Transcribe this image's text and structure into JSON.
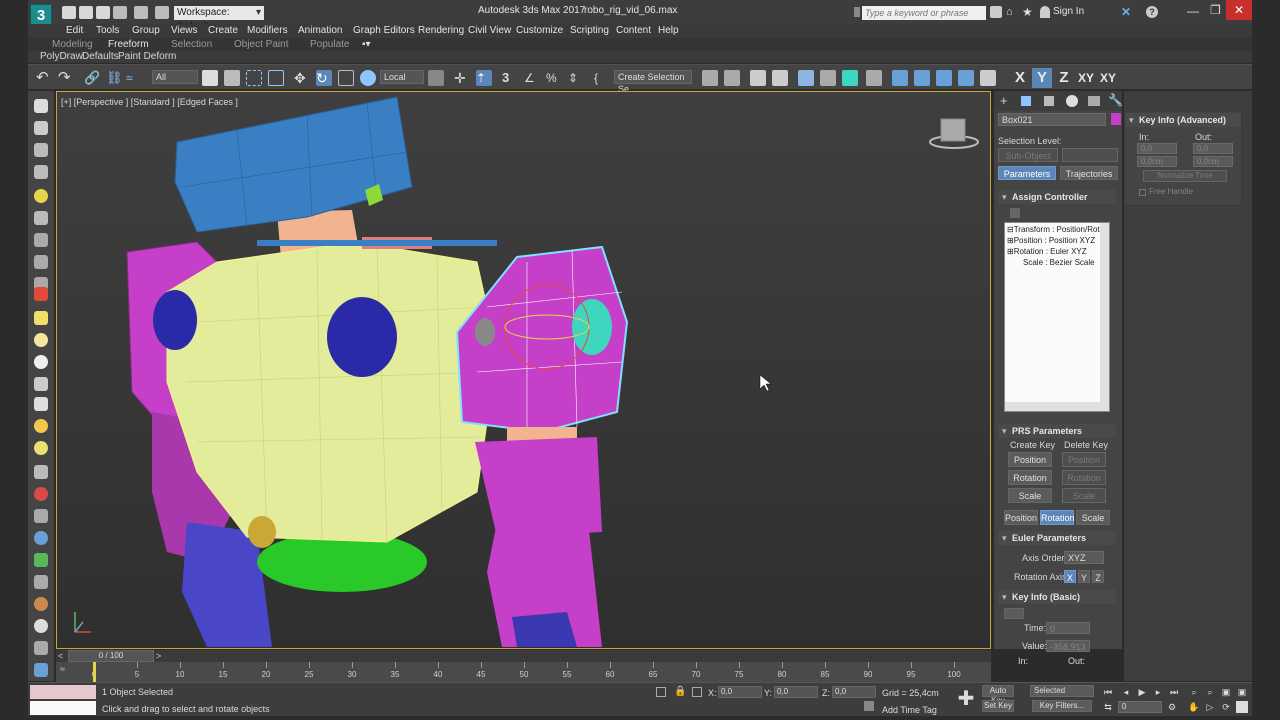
{
  "app": {
    "logo_label": "3",
    "logo_sub": "MAX",
    "title": "Autodesk 3ds Max 2017",
    "filename": "robo_rig_vid_06.max",
    "workspace_label": "Workspace: Default",
    "search_placeholder": "Type a keyword or phrase",
    "sign_in": "Sign In",
    "help": "?"
  },
  "menu": [
    "Edit",
    "Tools",
    "Group",
    "Views",
    "Create",
    "Modifiers",
    "Animation",
    "Graph Editors",
    "Rendering",
    "Civil View",
    "Customize",
    "Scripting",
    "Content",
    "Help"
  ],
  "ribbon": {
    "tabs": [
      "Modeling",
      "Freeform",
      "Selection",
      "Object Paint",
      "Populate"
    ],
    "active_tab": "Freeform",
    "subtabs": [
      "PolyDraw",
      "Defaults",
      "Paint Deform"
    ]
  },
  "toolbar": {
    "filter": "All",
    "ref_coord": "Local",
    "selection_set": "Create Selection Se",
    "axes": [
      "X",
      "Y",
      "Z",
      "XY",
      "XY"
    ],
    "active_axis": "Y"
  },
  "viewport": {
    "label": "[+] [Perspective ] [Standard ] [Edged Faces ]",
    "colors": {
      "border": "#c7a53a",
      "head": "#3a7fc4",
      "body": "#e3ec9a",
      "limb": "#c63fc8",
      "joint": "#2a2aa8",
      "hip": "#28c928",
      "neck": "#f2b391",
      "accent": "#3fd6c0"
    }
  },
  "command_panel": {
    "object_name": "Box021",
    "object_color": "#c63fc8",
    "selection_level_label": "Selection Level:",
    "sub_object": "Sub-Object",
    "tabs": [
      "Parameters",
      "Trajectories"
    ],
    "active_tab": "Parameters",
    "assign_controller": "Assign Controller",
    "tree": [
      "⊟Transform : Position/Rotat",
      "  ⊞Position : Position XYZ",
      "  ⊞Rotation : Euler XYZ",
      "  Scale : Bezier Scale"
    ],
    "prs": {
      "title": "PRS Parameters",
      "create_key": "Create Key",
      "delete_key": "Delete Key",
      "create_buttons": [
        "Position",
        "Rotation",
        "Scale"
      ],
      "delete_buttons": [
        "Position",
        "Rotation",
        "Scale"
      ],
      "mode_buttons": [
        "Position",
        "Rotation",
        "Scale"
      ],
      "active_mode": "Rotation"
    },
    "euler": {
      "title": "Euler Parameters",
      "axis_order_label": "Axis Order:",
      "axis_order": "XYZ",
      "rotation_axis_label": "Rotation Axis:",
      "axes": [
        "X",
        "Y",
        "Z"
      ],
      "active_axis": "X"
    },
    "key_basic": {
      "title": "Key Info (Basic)",
      "time_label": "Time:",
      "time_value": "0",
      "value_label": "Value:",
      "value_value": "-358,913",
      "in_label": "In:",
      "out_label": "Out:"
    }
  },
  "key_advanced": {
    "title": "Key Info (Advanced)",
    "in_label": "In:",
    "out_label": "Out:",
    "values_row1": [
      "0,0",
      "0,0"
    ],
    "values_row2": [
      "0,0cm",
      "0,0cm"
    ],
    "normalize": "Normalize Time",
    "free_handle": "Free Handle"
  },
  "timeline": {
    "slider": "0 / 100",
    "ticks": [
      0,
      5,
      10,
      15,
      20,
      25,
      30,
      35,
      40,
      45,
      50,
      55,
      60,
      65,
      70,
      75,
      80,
      85,
      90,
      95,
      100
    ]
  },
  "status": {
    "selected": "1 Object Selected",
    "prompt": "Click and drag to select and rotate objects",
    "x_label": "X:",
    "x": "0,0",
    "y_label": "Y:",
    "y": "0,0",
    "z_label": "Z:",
    "z": "0,0",
    "grid": "Grid = 25,4cm",
    "add_time_tag": "Add Time Tag",
    "auto_key": "Auto Key",
    "set_key": "Set Key",
    "selected_dd": "Selected",
    "key_filters": "Key Filters...",
    "frame": "0"
  }
}
